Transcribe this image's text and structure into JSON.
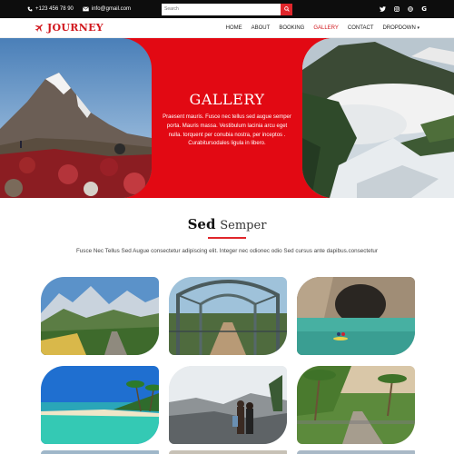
{
  "topbar": {
    "phone": "+123 456 78 90",
    "email": "info@gmail.com",
    "search_placeholder": "Search",
    "social_icons": [
      "twitter-icon",
      "instagram-icon",
      "globe-icon",
      "google-icon"
    ]
  },
  "brand": {
    "name": "JOURNEY",
    "icon": "airplane-icon",
    "color": "#d1181e"
  },
  "nav": {
    "items": [
      {
        "label": "HOME"
      },
      {
        "label": "ABOUT"
      },
      {
        "label": "BOOKING"
      },
      {
        "label": "GALLERY",
        "active": true
      },
      {
        "label": "CONTACT"
      },
      {
        "label": "DROPDOWN"
      }
    ],
    "dropdown_caret": "▾"
  },
  "banner": {
    "title": "GALLERY",
    "text": "Praesent mauris. Fusce nec tellus sed augue semper porta. Mauris massa. Vestibulum lacinia arcu eget nulla. torquent per conubia nostra, per inceptos . Curabitursodales ligula in libero.",
    "bg_color": "#e20913"
  },
  "section": {
    "title_bold": "Sed",
    "title_rest": "Semper",
    "description": "Fusce Nec Tellus Sed Augue consectetur adipiscing elit. Integer nec odionec odio Sed cursus ante dapibus.consectetur",
    "accent": "#e0262b"
  },
  "gallery": [
    {
      "name": "mountain-valley-photo"
    },
    {
      "name": "iron-bridge-photo"
    },
    {
      "name": "sea-cave-kayak-photo"
    },
    {
      "name": "tropical-beach-photo"
    },
    {
      "name": "couple-hiking-photo"
    },
    {
      "name": "palm-road-photo"
    }
  ]
}
